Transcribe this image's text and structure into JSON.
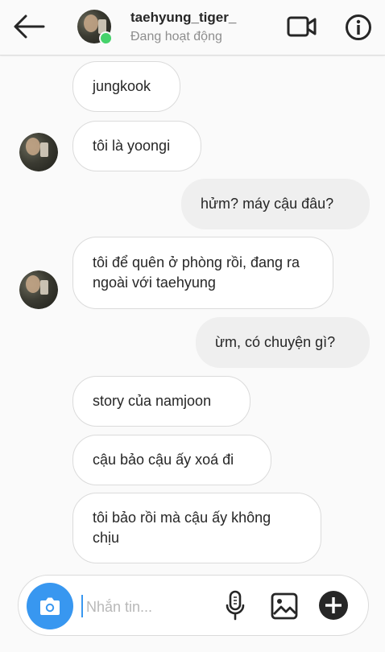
{
  "header": {
    "username": "taehyung_tiger_",
    "status": "Đang hoạt động"
  },
  "messages": [
    {
      "direction": "in",
      "text": "jungkook"
    },
    {
      "direction": "in",
      "text": "tôi là yoongi"
    },
    {
      "direction": "out",
      "text": "hửm? máy cậu đâu?"
    },
    {
      "direction": "in",
      "text": "tôi để quên ở phòng rồi, đang ra ngoài với taehyung"
    },
    {
      "direction": "out",
      "text": "ừm, có chuyện gì?"
    },
    {
      "direction": "in",
      "text": "story của namjoon"
    },
    {
      "direction": "in",
      "text": "cậu bảo cậu ấy xoá đi"
    },
    {
      "direction": "in",
      "text": "tôi bảo rồi mà cậu ấy không chịu"
    }
  ],
  "composer": {
    "placeholder": "Nhắn tin..."
  },
  "colors": {
    "accent": "#3897f0",
    "online": "#45d26b",
    "incoming_bubble": "#ffffff",
    "outgoing_bubble": "#efefef"
  },
  "icons": [
    "back-arrow-icon",
    "video-call-icon",
    "info-icon",
    "camera-icon",
    "microphone-icon",
    "image-icon",
    "plus-icon"
  ]
}
